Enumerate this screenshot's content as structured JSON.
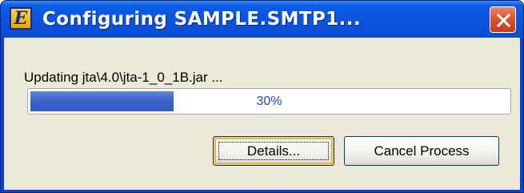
{
  "window": {
    "title": "Configuring SAMPLE.SMTP1...",
    "app_icon_letter": "E",
    "icons": {
      "app": "application-logo-icon",
      "close": "close-icon"
    },
    "colors": {
      "titlebar": "#0a55df",
      "close_button": "#d9532e",
      "dialog_background": "#ece9d8",
      "progress_fill": "#3a66c8"
    }
  },
  "status": {
    "message": "Updating jta\\4.0\\jta-1_0_1B.jar ..."
  },
  "progress": {
    "percent": 30,
    "label": "30%"
  },
  "buttons": {
    "details_label": "Details...",
    "cancel_label": "Cancel Process"
  }
}
